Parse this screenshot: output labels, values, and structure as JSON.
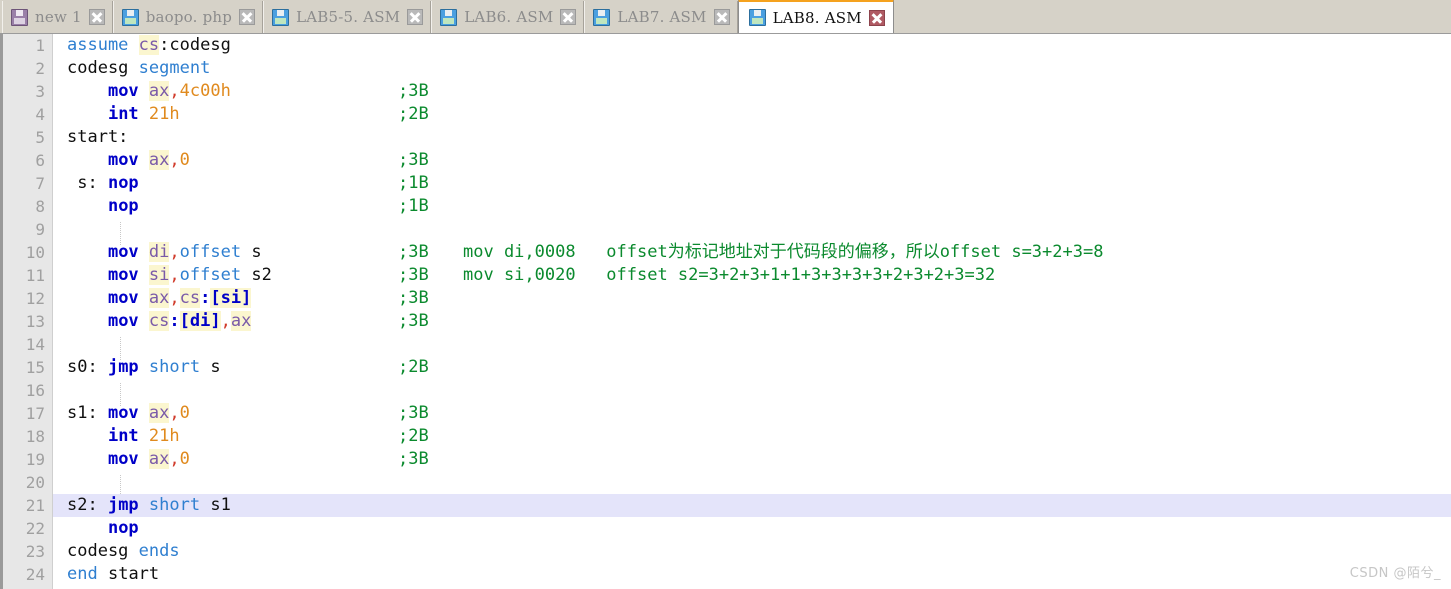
{
  "tabs": [
    {
      "label": "new 1",
      "icon": "floppy-disk-icon",
      "color": "purple",
      "active": false,
      "close": "close-icon"
    },
    {
      "label": "baopo. php",
      "icon": "floppy-disk-icon",
      "color": "green",
      "active": false,
      "close": "close-icon"
    },
    {
      "label": "LAB5-5. ASM",
      "icon": "floppy-disk-icon",
      "color": "green",
      "active": false,
      "close": "close-icon"
    },
    {
      "label": "LAB6. ASM",
      "icon": "floppy-disk-icon",
      "color": "green",
      "active": false,
      "close": "close-icon"
    },
    {
      "label": "LAB7. ASM",
      "icon": "floppy-disk-icon",
      "color": "green",
      "active": false,
      "close": "close-icon"
    },
    {
      "label": "LAB8. ASM",
      "icon": "floppy-disk-icon",
      "color": "green",
      "active": true,
      "close": "close-icon"
    }
  ],
  "editor": {
    "current_line": 21,
    "line_numbers": [
      "1",
      "2",
      "3",
      "4",
      "5",
      "6",
      "7",
      "8",
      "9",
      "10",
      "11",
      "12",
      "13",
      "14",
      "15",
      "16",
      "17",
      "18",
      "19",
      "20",
      "21",
      "22",
      "23",
      "24"
    ],
    "lines": [
      {
        "n": "1",
        "text": "assume cs:codesg"
      },
      {
        "n": "2",
        "text": "codesg segment"
      },
      {
        "n": "3",
        "text": "    mov ax,4c00h",
        "comment": ";3B"
      },
      {
        "n": "4",
        "text": "    int 21h",
        "comment": ";2B"
      },
      {
        "n": "5",
        "text": "start:"
      },
      {
        "n": "6",
        "text": "    mov ax,0",
        "comment": ";3B"
      },
      {
        "n": "7",
        "text": " s: nop",
        "comment": ";1B"
      },
      {
        "n": "8",
        "text": "    nop",
        "comment": ";1B"
      },
      {
        "n": "9",
        "text": ""
      },
      {
        "n": "10",
        "text": "    mov di,offset s",
        "comment": ";3B",
        "comment2": "mov di,0008   offset为标记地址对于代码段的偏移，所以offset s=3+2+3=8"
      },
      {
        "n": "11",
        "text": "    mov si,offset s2",
        "comment": ";3B",
        "comment2": "mov si,0020   offset s2=3+2+3+1+1+3+3+3+3+2+3+2+3=32"
      },
      {
        "n": "12",
        "text": "    mov ax,cs:[si]",
        "comment": ";3B"
      },
      {
        "n": "13",
        "text": "    mov cs:[di],ax",
        "comment": ";3B"
      },
      {
        "n": "14",
        "text": ""
      },
      {
        "n": "15",
        "text": "s0: jmp short s",
        "comment": ";2B"
      },
      {
        "n": "16",
        "text": ""
      },
      {
        "n": "17",
        "text": "s1: mov ax,0",
        "comment": ";3B"
      },
      {
        "n": "18",
        "text": "    int 21h",
        "comment": ";2B"
      },
      {
        "n": "19",
        "text": "    mov ax,0",
        "comment": ";3B"
      },
      {
        "n": "20",
        "text": ""
      },
      {
        "n": "21",
        "text": "s2: jmp short s1"
      },
      {
        "n": "22",
        "text": "    nop"
      },
      {
        "n": "23",
        "text": "codesg ends"
      },
      {
        "n": "24",
        "text": "end start"
      }
    ]
  },
  "watermark": "CSDN @陌兮_",
  "colors": {
    "active_tab_accent": "#f5a21e",
    "keyword": "#2f7fd0",
    "mnemonic": "#0000c8",
    "register": "#7a5aa8",
    "register_highlight": "#fbf6cf",
    "number": "#e08a1e",
    "punctuation": "#d03a2a",
    "comment": "#0b8a2e",
    "current_line_bg": "#e4e4fa",
    "gutter_bg": "#e7e7e7",
    "tabbar_bg": "#d6d2c8"
  }
}
